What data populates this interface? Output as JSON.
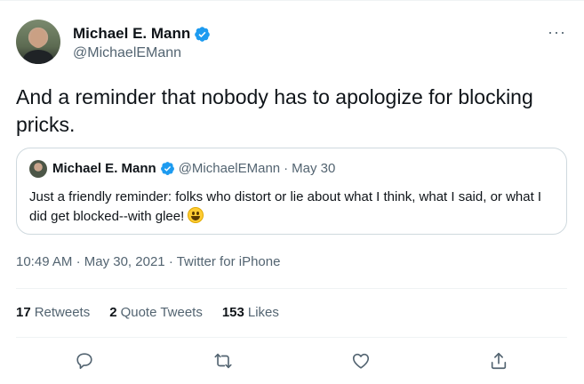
{
  "author": {
    "name": "Michael E. Mann",
    "handle": "@MichaelEMann",
    "verified": true
  },
  "tweet": {
    "text": "And a reminder that nobody has to apologize for blocking pricks."
  },
  "quoted": {
    "name": "Michael E. Mann",
    "handle": "@MichaelEMann",
    "separator": "·",
    "date": "May 30",
    "text": "Just a friendly reminder: folks who distort or lie about what I think, what I said, or what I did get blocked--with glee!",
    "emoji": "grinning-face-emoji"
  },
  "meta": {
    "time": "10:49 AM",
    "dot1": "·",
    "date": "May 30, 2021",
    "dot2": "·",
    "source": "Twitter for iPhone"
  },
  "stats": {
    "retweets_count": "17",
    "retweets_label": "Retweets",
    "quotes_count": "2",
    "quotes_label": "Quote Tweets",
    "likes_count": "153",
    "likes_label": "Likes"
  },
  "more_label": "···",
  "icons": {
    "verified": "verified-badge-icon",
    "reply": "reply-icon",
    "retweet": "retweet-icon",
    "like": "heart-icon",
    "share": "share-icon"
  },
  "colors": {
    "verified": "#1d9bf0",
    "text": "#0f1419",
    "secondary": "#536471",
    "border": "#cfd9de"
  }
}
